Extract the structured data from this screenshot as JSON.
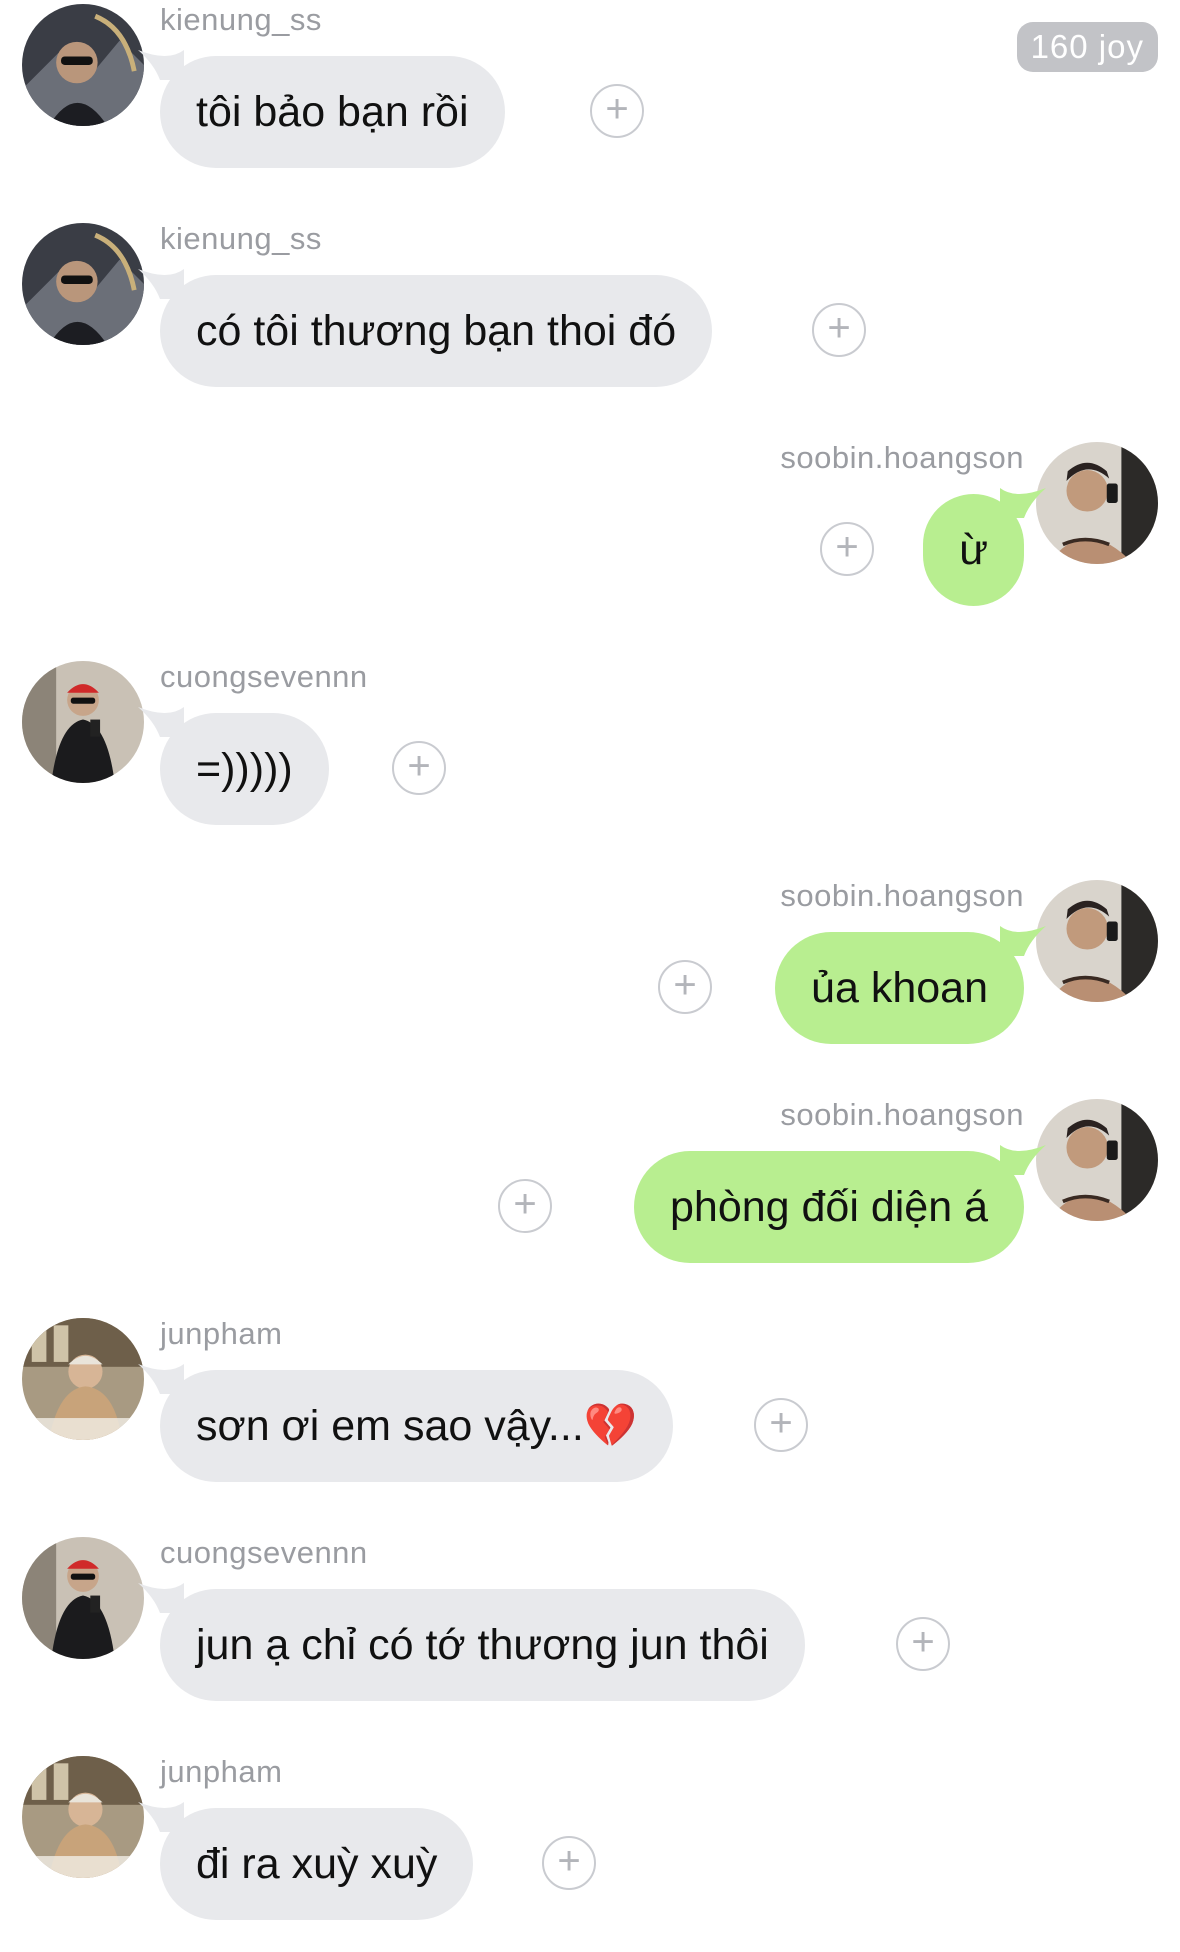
{
  "badge": {
    "label": "160 joy"
  },
  "messages": [
    {
      "user": "kienung_ss",
      "text": "tôi bảo bạn rồi",
      "side": "left",
      "avatar": "avatar-kienung-icon"
    },
    {
      "user": "kienung_ss",
      "text": "có tôi thương bạn thoi đó",
      "side": "left",
      "avatar": "avatar-kienung-icon"
    },
    {
      "user": "soobin.hoangson",
      "text": "ừ",
      "side": "right",
      "avatar": "avatar-soobin-icon"
    },
    {
      "user": "cuongsevennn",
      "text": "=)))))",
      "side": "left",
      "avatar": "avatar-cuong-icon"
    },
    {
      "user": "soobin.hoangson",
      "text": "ủa khoan",
      "side": "right",
      "avatar": "avatar-soobin-icon"
    },
    {
      "user": "soobin.hoangson",
      "text": "phòng đối diện á",
      "side": "right",
      "avatar": "avatar-soobin-icon"
    },
    {
      "user": "junpham",
      "text": "sơn ơi em sao vậy...💔",
      "side": "left",
      "avatar": "avatar-jun-icon"
    },
    {
      "user": "cuongsevennn",
      "text": "jun ạ chỉ có tớ thương jun thôi",
      "side": "left",
      "avatar": "avatar-cuong-icon"
    },
    {
      "user": "junpham",
      "text": "đi ra xuỳ xuỳ",
      "side": "left",
      "avatar": "avatar-jun-icon"
    }
  ],
  "colors": {
    "received_bubble": "#e8e9ec",
    "sent_bubble": "#b8ee90",
    "username": "#9a9ca1",
    "badge_bg": "#c2c3c7"
  },
  "add_reaction_icon": "plus-circle-icon"
}
